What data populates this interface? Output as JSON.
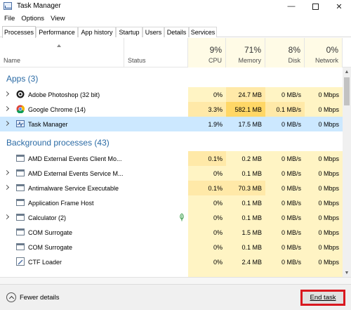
{
  "window": {
    "title": "Task Manager",
    "controls": [
      "—",
      "",
      "✕"
    ]
  },
  "menu": [
    "File",
    "Options",
    "View"
  ],
  "tabs": [
    "Processes",
    "Performance",
    "App history",
    "Startup",
    "Users",
    "Details",
    "Services"
  ],
  "active_tab": "Processes",
  "columns": {
    "name": "Name",
    "status": "Status",
    "cpu": {
      "pct": "9%",
      "label": "CPU"
    },
    "memory": {
      "pct": "71%",
      "label": "Memory"
    },
    "disk": {
      "pct": "8%",
      "label": "Disk"
    },
    "network": {
      "pct": "0%",
      "label": "Network"
    }
  },
  "groups": {
    "apps": "Apps (3)",
    "background": "Background processes (43)"
  },
  "apps": [
    {
      "name": "Adobe Photoshop (32 bit)",
      "icon": "photoshop-icon",
      "cpu": "0%",
      "mem": "24.7 MB",
      "disk": "0 MB/s",
      "net": "0 Mbps"
    },
    {
      "name": "Google Chrome (14)",
      "icon": "chrome-icon",
      "cpu": "3.3%",
      "mem": "582.1 MB",
      "disk": "0.1 MB/s",
      "net": "0 Mbps"
    },
    {
      "name": "Task Manager",
      "icon": "task-manager-icon",
      "cpu": "1.9%",
      "mem": "17.5 MB",
      "disk": "0 MB/s",
      "net": "0 Mbps"
    }
  ],
  "background": [
    {
      "name": "AMD External Events Client Mo...",
      "cpu": "0.1%",
      "mem": "0.2 MB",
      "disk": "0 MB/s",
      "net": "0 Mbps"
    },
    {
      "name": "AMD External Events Service M...",
      "cpu": "0%",
      "mem": "0.1 MB",
      "disk": "0 MB/s",
      "net": "0 Mbps"
    },
    {
      "name": "Antimalware Service Executable",
      "cpu": "0.1%",
      "mem": "70.3 MB",
      "disk": "0 MB/s",
      "net": "0 Mbps"
    },
    {
      "name": "Application Frame Host",
      "cpu": "0%",
      "mem": "0.1 MB",
      "disk": "0 MB/s",
      "net": "0 Mbps"
    },
    {
      "name": "Calculator (2)",
      "cpu": "0%",
      "mem": "0.1 MB",
      "disk": "0 MB/s",
      "net": "0 Mbps"
    },
    {
      "name": "COM Surrogate",
      "cpu": "0%",
      "mem": "1.5 MB",
      "disk": "0 MB/s",
      "net": "0 Mbps"
    },
    {
      "name": "COM Surrogate",
      "cpu": "0%",
      "mem": "0.1 MB",
      "disk": "0 MB/s",
      "net": "0 Mbps"
    },
    {
      "name": "CTF Loader",
      "cpu": "0%",
      "mem": "2.4 MB",
      "disk": "0 MB/s",
      "net": "0 Mbps"
    }
  ],
  "footer": {
    "fewer_details": "Fewer details",
    "end_task": "End task"
  },
  "colors": {
    "accent_red": "#d9181f",
    "group_blue": "#2b6ba5",
    "selected": "#cce8ff",
    "heat_light": "#fff4c4",
    "heat_high": "#ffd766"
  }
}
